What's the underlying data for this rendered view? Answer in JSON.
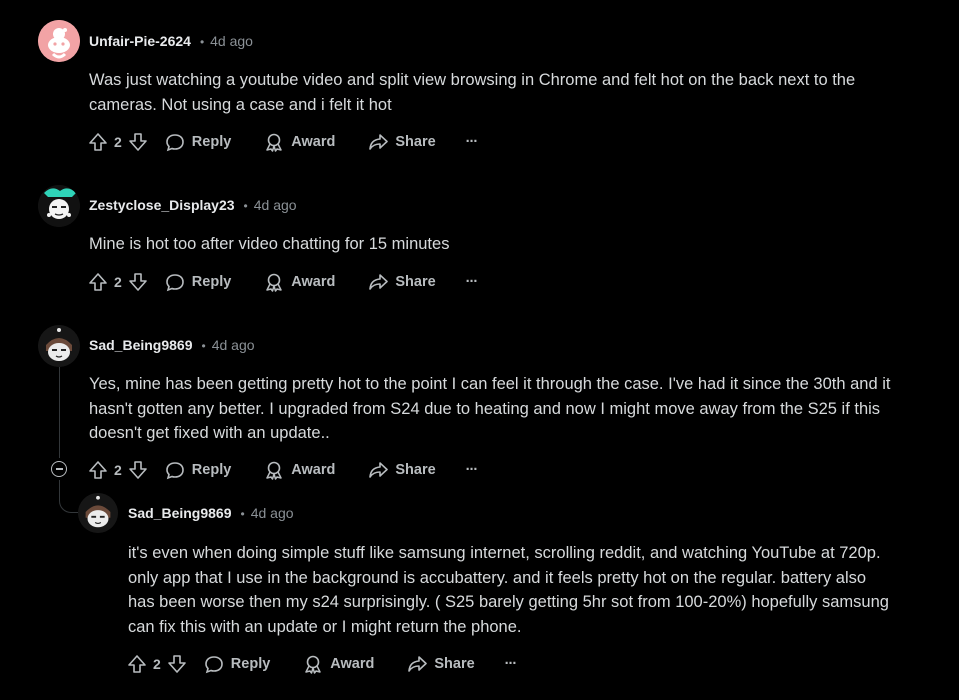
{
  "comments": [
    {
      "username": "Unfair-Pie-2624",
      "dot": "•",
      "time": "4d ago",
      "body": [
        "Was just watching a youtube video and split view browsing in Chrome and felt hot on the back next to the",
        "cameras. Not using a case and i felt it hot"
      ],
      "votes": "2",
      "reply": "Reply",
      "award": "Award",
      "share": "Share",
      "more": "···"
    },
    {
      "username": "Zestyclose_Display23",
      "dot": "•",
      "time": "4d ago",
      "body": [
        "Mine is hot too after video chatting for 15 minutes"
      ],
      "votes": "2",
      "reply": "Reply",
      "award": "Award",
      "share": "Share",
      "more": "···"
    },
    {
      "username": "Sad_Being9869",
      "dot": "•",
      "time": "4d ago",
      "body": [
        "Yes, mine has been getting pretty hot to the point I can feel it through the case. I've had it since the 30th and it",
        "hasn't gotten any better. I upgraded from S24 due to heating and now I might move away from the S25 if this",
        "doesn't get fixed with an update.."
      ],
      "votes": "2",
      "reply": "Reply",
      "award": "Award",
      "share": "Share",
      "more": "···"
    },
    {
      "username": "Sad_Being9869",
      "dot": "•",
      "time": "4d ago",
      "body": [
        "it's even when doing simple stuff like samsung internet, scrolling reddit, and watching YouTube at 720p.",
        "only app that I use in the background is accubattery. and it feels pretty hot on the regular. battery also",
        "has been worse then my s24 surprisingly. ( S25 barely getting 5hr sot from 100-20%) hopefully samsung",
        "can fix this with an update or I might return the phone."
      ],
      "votes": "2",
      "reply": "Reply",
      "award": "Award",
      "share": "Share",
      "more": "···"
    }
  ],
  "colors": {
    "background": "#000000",
    "text": "#d7dadc",
    "muted": "#8b9196",
    "thread_line": "#33373a",
    "avatar_pink": "#f4a6a6"
  },
  "icons": [
    "upvote-icon",
    "downvote-icon",
    "reply-icon",
    "award-icon",
    "share-icon",
    "more-icon",
    "collapse-icon"
  ]
}
